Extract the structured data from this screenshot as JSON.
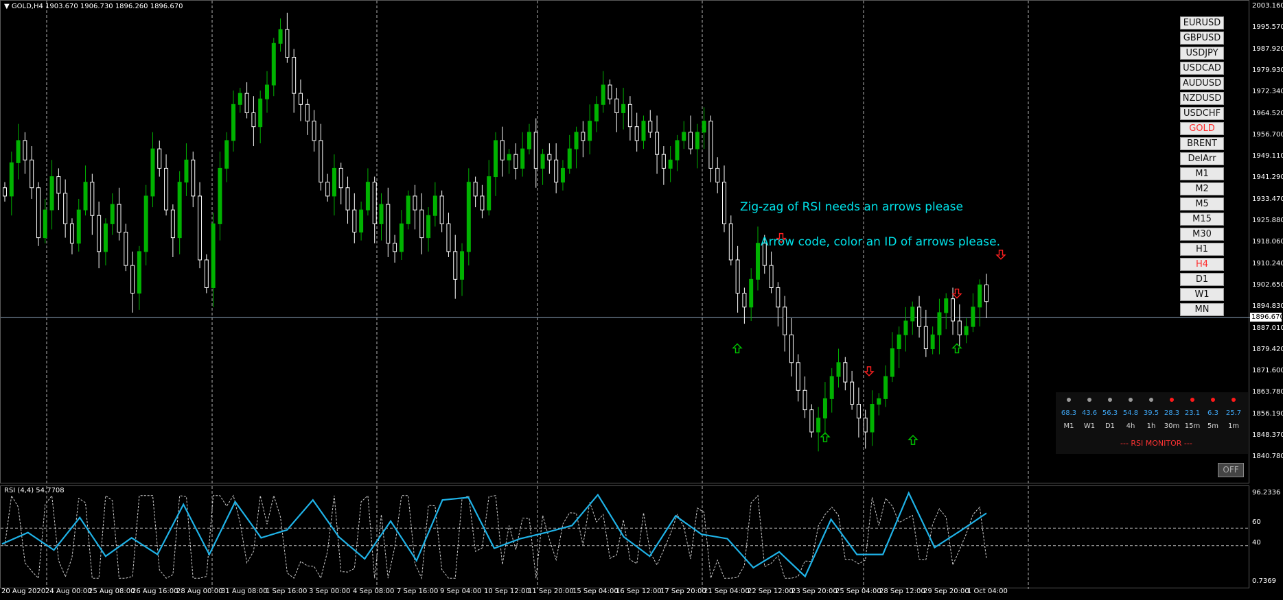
{
  "chart_header": {
    "symbol_timeframe": "GOLD,H4",
    "ohlc": "1903.670 1906.730 1896.260 1896.670"
  },
  "price_axis": [
    "2003.160",
    "1995.570",
    "1987.920",
    "1979.930",
    "1972.340",
    "1964.520",
    "1956.700",
    "1949.110",
    "1941.290",
    "1933.470",
    "1925.880",
    "1918.060",
    "1910.240",
    "1902.650",
    "1894.830",
    "1887.010",
    "1879.420",
    "1871.600",
    "1863.780",
    "1856.190",
    "1848.370",
    "1840.780"
  ],
  "current_price": "1896.670",
  "rsi_title": "RSI (4,4) 54.7708",
  "rsi_axis": {
    "max": "96.2336",
    "level_high": "60",
    "level_low": "40",
    "min": "0.7369"
  },
  "time_axis": [
    "20 Aug 2020",
    "24 Aug 00:00",
    "25 Aug 08:00",
    "26 Aug 16:00",
    "28 Aug 00:00",
    "31 Aug 08:00",
    "1 Sep 16:00",
    "3 Sep 00:00",
    "4 Sep 08:00",
    "7 Sep 16:00",
    "9 Sep 04:00",
    "10 Sep 12:00",
    "11 Sep 20:00",
    "15 Sep 04:00",
    "16 Sep 12:00",
    "17 Sep 20:00",
    "21 Sep 04:00",
    "22 Sep 12:00",
    "23 Sep 20:00",
    "25 Sep 04:00",
    "28 Sep 12:00",
    "29 Sep 20:00",
    "1 Oct 04:00"
  ],
  "symbol_buttons": [
    {
      "label": "EURUSD",
      "active": false
    },
    {
      "label": "GBPUSD",
      "active": false
    },
    {
      "label": "USDJPY",
      "active": false
    },
    {
      "label": "USDCAD",
      "active": false
    },
    {
      "label": "AUDUSD",
      "active": false
    },
    {
      "label": "NZDUSD",
      "active": false
    },
    {
      "label": "USDCHF",
      "active": false
    },
    {
      "label": "GOLD",
      "active": true
    },
    {
      "label": "BRENT",
      "active": false
    },
    {
      "label": "DelArr",
      "active": false
    },
    {
      "label": "M1",
      "active": false
    },
    {
      "label": "M2",
      "active": false
    },
    {
      "label": "M5",
      "active": false
    },
    {
      "label": "M15",
      "active": false
    },
    {
      "label": "M30",
      "active": false
    },
    {
      "label": "H1",
      "active": false
    },
    {
      "label": "H4",
      "active": true
    },
    {
      "label": "D1",
      "active": false
    },
    {
      "label": "W1",
      "active": false
    },
    {
      "label": "MN",
      "active": false
    }
  ],
  "annotations": {
    "line1": "Zig-zag of RSI needs an arrows please",
    "line2": "Arrow code, color an ID of arrows please."
  },
  "rsi_monitor": {
    "title": "--- RSI MONITOR ---",
    "items": [
      {
        "tf": "M1",
        "value": "68.3",
        "dot": "#9a9a9a"
      },
      {
        "tf": "W1",
        "value": "43.6",
        "dot": "#9a9a9a"
      },
      {
        "tf": "D1",
        "value": "56.3",
        "dot": "#9a9a9a"
      },
      {
        "tf": "4h",
        "value": "54.8",
        "dot": "#9a9a9a"
      },
      {
        "tf": "1h",
        "value": "39.5",
        "dot": "#9a9a9a"
      },
      {
        "tf": "30m",
        "value": "28.3",
        "dot": "#ff1a1a"
      },
      {
        "tf": "15m",
        "value": "23.1",
        "dot": "#ff1a1a"
      },
      {
        "tf": "5m",
        "value": "6.3",
        "dot": "#ff1a1a"
      },
      {
        "tf": "1m",
        "value": "25.7",
        "dot": "#ff1a1a"
      }
    ]
  },
  "off_button": "OFF",
  "colors": {
    "bull": "#00b200",
    "bear": "#ffffff",
    "grid": "#b4b4b4",
    "zigzag": "#1fb3e8",
    "rsi_line": "#cccccc",
    "arrow_up": "#00c800",
    "arrow_down": "#ff2020",
    "price_line": "#8fa8c0"
  },
  "chart_data": {
    "type": "candlestick",
    "symbol": "GOLD",
    "timeframe": "H4",
    "ylim": [
      1840.78,
      2003.16
    ],
    "closes": [
      1935,
      1947,
      1955,
      1948,
      1938,
      1920,
      1930,
      1942,
      1936,
      1925,
      1918,
      1930,
      1940,
      1928,
      1915,
      1925,
      1932,
      1922,
      1910,
      1900,
      1915,
      1935,
      1952,
      1945,
      1930,
      1920,
      1940,
      1948,
      1935,
      1912,
      1902,
      1925,
      1945,
      1955,
      1968,
      1972,
      1965,
      1960,
      1970,
      1975,
      1990,
      1995,
      1985,
      1972,
      1968,
      1962,
      1955,
      1940,
      1935,
      1945,
      1938,
      1930,
      1922,
      1930,
      1940,
      1925,
      1932,
      1918,
      1915,
      1925,
      1935,
      1930,
      1920,
      1928,
      1935,
      1925,
      1915,
      1905,
      1915,
      1940,
      1935,
      1930,
      1942,
      1955,
      1948,
      1950,
      1945,
      1952,
      1958,
      1945,
      1950,
      1948,
      1940,
      1945,
      1952,
      1958,
      1955,
      1962,
      1968,
      1975,
      1970,
      1965,
      1968,
      1960,
      1955,
      1962,
      1958,
      1950,
      1945,
      1948,
      1955,
      1958,
      1952,
      1958,
      1962,
      1945,
      1940,
      1925,
      1912,
      1900,
      1895,
      1905,
      1918,
      1910,
      1902,
      1895,
      1885,
      1875,
      1865,
      1858,
      1850,
      1855,
      1862,
      1870,
      1875,
      1868,
      1860,
      1855,
      1850,
      1860,
      1862,
      1870,
      1880,
      1885,
      1890,
      1895,
      1888,
      1880,
      1885,
      1893,
      1898,
      1890,
      1885,
      1888,
      1895,
      1903,
      1897
    ],
    "rsi_zigzag": [
      42,
      55,
      35,
      72,
      28,
      49,
      30,
      87,
      30,
      90,
      49,
      58,
      92,
      50,
      25,
      68,
      23,
      92,
      95,
      37,
      48,
      55,
      63,
      98,
      50,
      28,
      74,
      53,
      48,
      15,
      33,
      5,
      70,
      30,
      30,
      100,
      38,
      57,
      77
    ],
    "arrows": [
      {
        "direction": "up",
        "time": "21 Sep 04:00",
        "price": 1880
      },
      {
        "direction": "down",
        "time": "22 Sep 12:00",
        "price": 1920
      },
      {
        "direction": "up",
        "time": "23 Sep 20:00",
        "price": 1848
      },
      {
        "direction": "down",
        "time": "25 Sep 04:00",
        "price": 1872
      },
      {
        "direction": "up",
        "time": "28 Sep 12:00",
        "price": 1847
      },
      {
        "direction": "down",
        "time": "29 Sep 20:00",
        "price": 1900
      },
      {
        "direction": "up",
        "time": "29 Sep 20:00",
        "price": 1880
      },
      {
        "direction": "down",
        "time": "1 Oct 04:00",
        "price": 1914
      }
    ]
  }
}
